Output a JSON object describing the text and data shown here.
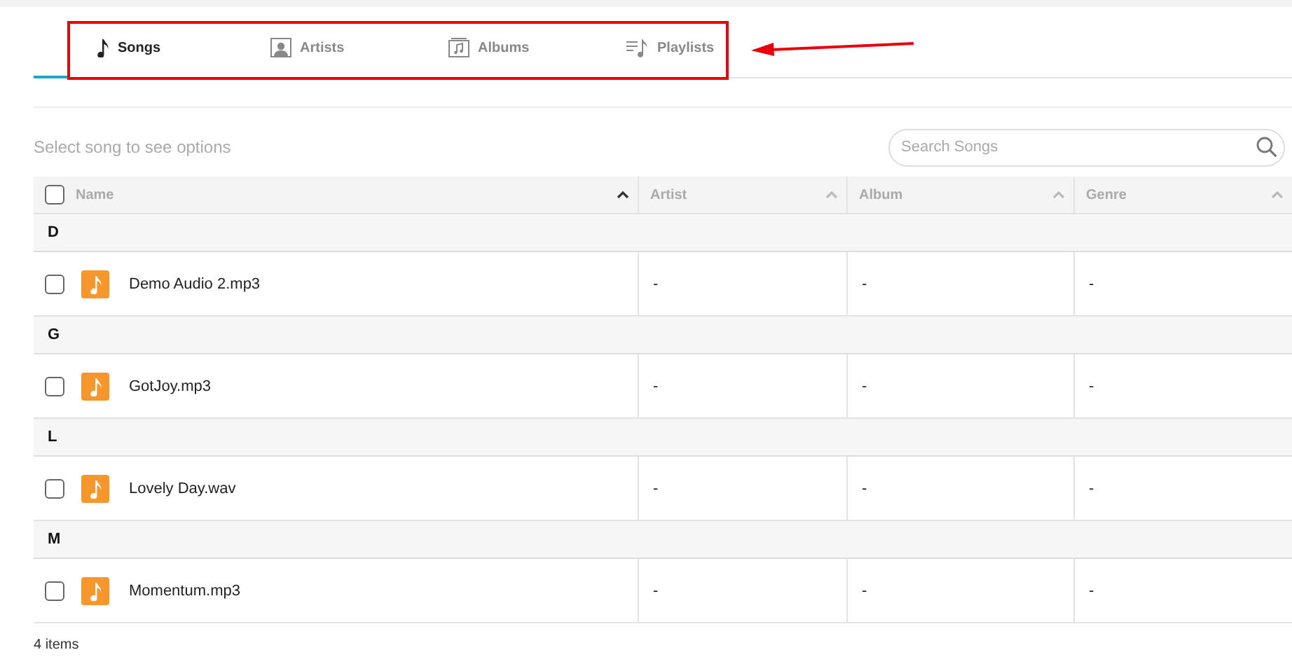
{
  "tabs": [
    {
      "label": "Songs",
      "kind": "song",
      "selected": true
    },
    {
      "label": "Artists",
      "kind": "artist",
      "selected": false
    },
    {
      "label": "Albums",
      "kind": "album",
      "selected": false
    },
    {
      "label": "Playlists",
      "kind": "playlist",
      "selected": false
    }
  ],
  "hint": "Select song to see options",
  "search": {
    "placeholder": "Search Songs"
  },
  "select_all": {
    "checked": false
  },
  "columns": [
    {
      "label": "Name",
      "sorted": true
    },
    {
      "label": "Artist",
      "sorted": false
    },
    {
      "label": "Album",
      "sorted": false
    },
    {
      "label": "Genre",
      "sorted": false
    }
  ],
  "groups": [
    {
      "letter": "D",
      "songs": [
        {
          "name": "Demo Audio 2.mp3",
          "artist": "-",
          "album": "-",
          "genre": "-",
          "checked": false
        }
      ]
    },
    {
      "letter": "G",
      "songs": [
        {
          "name": "GotJoy.mp3",
          "artist": "-",
          "album": "-",
          "genre": "-",
          "checked": false
        }
      ]
    },
    {
      "letter": "L",
      "songs": [
        {
          "name": "Lovely Day.wav",
          "artist": "-",
          "album": "-",
          "genre": "-",
          "checked": false
        }
      ]
    },
    {
      "letter": "M",
      "songs": [
        {
          "name": "Momentum.mp3",
          "artist": "-",
          "album": "-",
          "genre": "-",
          "checked": false
        }
      ]
    }
  ],
  "footer": "4 items"
}
